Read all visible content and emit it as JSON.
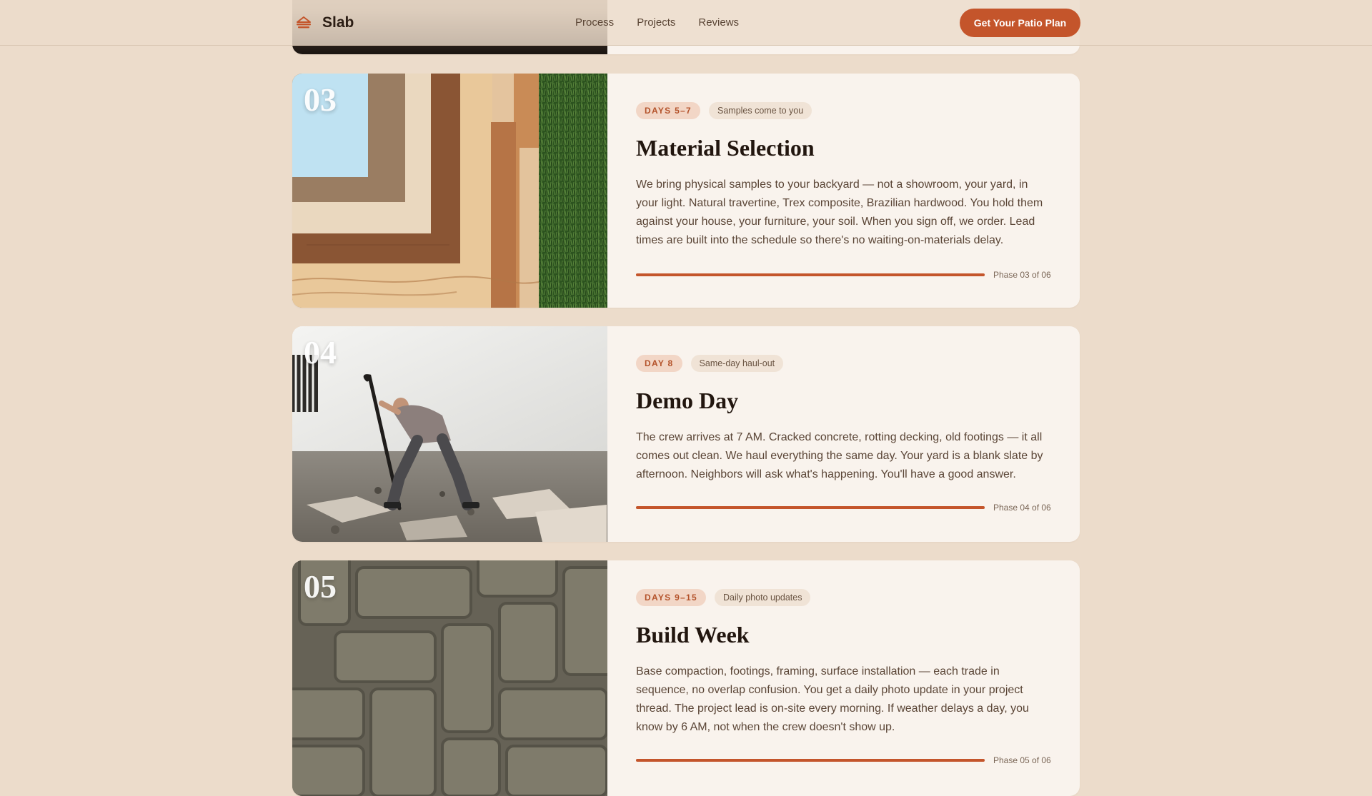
{
  "brand": {
    "name": "Slab",
    "icon": "stacked-slab-icon",
    "accent": "#c4552b"
  },
  "nav": {
    "links": [
      "Process",
      "Projects",
      "Reviews"
    ]
  },
  "cta": {
    "label": "Get Your Patio Plan"
  },
  "phases": [
    {
      "number": "03",
      "days": "DAYS 5–7",
      "note": "Samples come to you",
      "title": "Material Selection",
      "description": "We bring physical samples to your backyard — not a showroom, your yard, in your light. Natural travertine, Trex composite, Brazilian hardwood. You hold them against your house, your furniture, your soil. When you sign off, we order. Lead times are built into the schedule so there's no waiting-on-materials delay.",
      "progress_fill": 1.0,
      "progress_label": "Phase 03 of 06",
      "image": "material-samples-on-grass"
    },
    {
      "number": "04",
      "days": "DAY 8",
      "note": "Same-day haul-out",
      "title": "Demo Day",
      "description": "The crew arrives at 7 AM. Cracked concrete, rotting decking, old footings — it all comes out clean. We haul everything the same day. Your yard is a blank slate by afternoon. Neighbors will ask what's happening. You'll have a good answer.",
      "progress_fill": 1.0,
      "progress_label": "Phase 04 of 06",
      "image": "worker-breaking-concrete"
    },
    {
      "number": "05",
      "days": "DAYS 9–15",
      "note": "Daily photo updates",
      "title": "Build Week",
      "description": "Base compaction, footings, framing, surface installation — each trade in sequence, no overlap confusion. You get a daily photo update in your project thread. The project lead is on-site every morning. If weather delays a day, you know by 6 AM, not when the crew doesn't show up.",
      "progress_fill": 1.0,
      "progress_label": "Phase 05 of 06",
      "image": "herringbone-pavers"
    }
  ]
}
